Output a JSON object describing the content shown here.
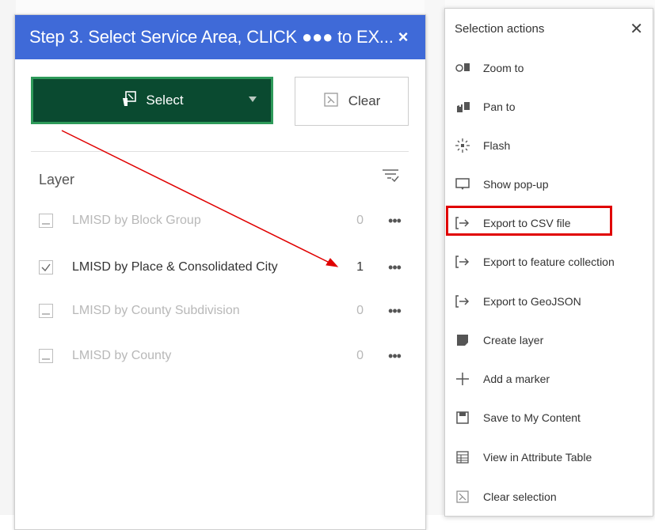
{
  "panel": {
    "title": "Step 3. Select Service Area, CLICK ●●● to EX...",
    "close": "×",
    "select_label": "Select",
    "clear_label": "Clear",
    "layer_heading": "Layer",
    "layers": [
      {
        "name": "LMISD by Block Group",
        "count": "0",
        "more": "•••",
        "selected": false
      },
      {
        "name": "LMISD by Place & Consolidated City",
        "count": "1",
        "more": "•••",
        "selected": true
      },
      {
        "name": "LMISD by County Subdivision",
        "count": "0",
        "more": "•••",
        "selected": false
      },
      {
        "name": "LMISD by County",
        "count": "0",
        "more": "•••",
        "selected": false
      }
    ]
  },
  "menu": {
    "title": "Selection actions",
    "close": "✕",
    "items": [
      {
        "label": "Zoom to",
        "icon": "zoom-to-icon"
      },
      {
        "label": "Pan to",
        "icon": "pan-to-icon"
      },
      {
        "label": "Flash",
        "icon": "flash-icon"
      },
      {
        "label": "Show pop-up",
        "icon": "popup-icon"
      },
      {
        "label": "Export to CSV file",
        "icon": "export-icon"
      },
      {
        "label": "Export to feature collection",
        "icon": "export-icon"
      },
      {
        "label": "Export to GeoJSON",
        "icon": "export-icon"
      },
      {
        "label": "Create layer",
        "icon": "create-layer-icon"
      },
      {
        "label": "Add a marker",
        "icon": "plus-icon"
      },
      {
        "label": "Save to My Content",
        "icon": "save-icon"
      },
      {
        "label": "View in Attribute Table",
        "icon": "table-icon"
      },
      {
        "label": "Clear selection",
        "icon": "clear-selection-icon"
      }
    ],
    "highlighted_item": "Export to CSV file"
  },
  "colors": {
    "header": "#3f6ad8",
    "select_button": "#0a4a30",
    "highlight": "#e00000",
    "arrow": "#e00000"
  }
}
